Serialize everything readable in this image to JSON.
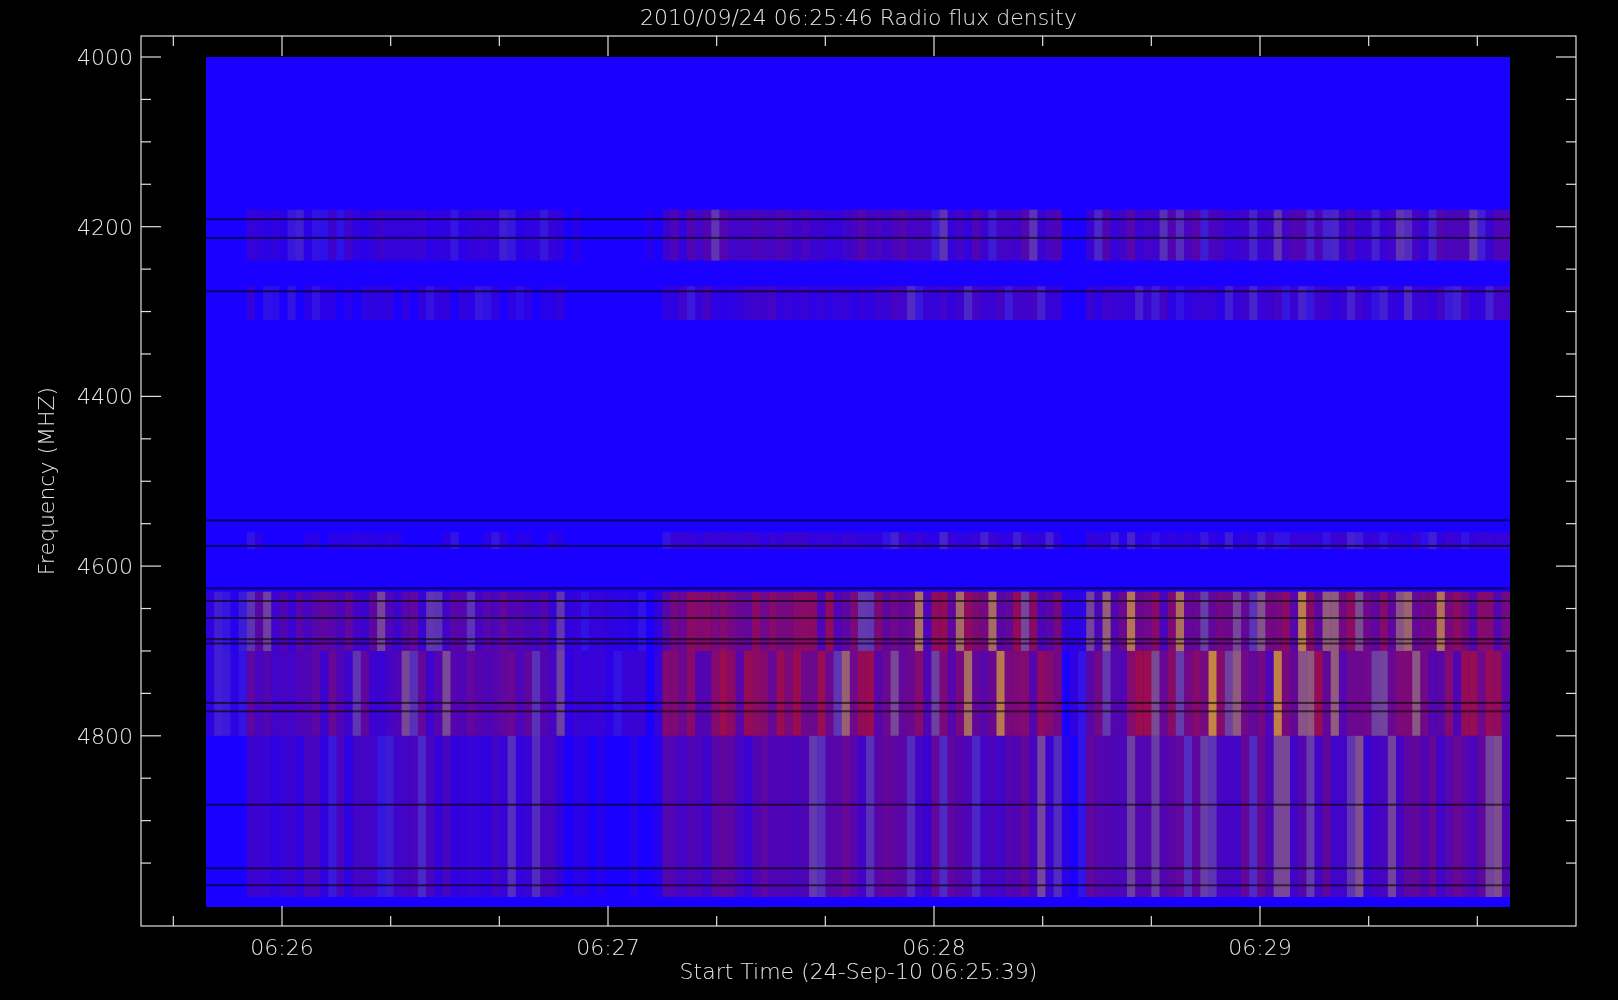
{
  "title": "2010/09/24 06:25:46 Radio flux density",
  "y_axis": {
    "label": "Frequency (MHZ)",
    "tick_labels": [
      "4000",
      "4200",
      "4400",
      "4600",
      "4800"
    ]
  },
  "x_axis": {
    "label": "Start Time (24-Sep-10 06:25:39)",
    "tick_labels": [
      "06:26",
      "06:27",
      "06:28",
      "06:29"
    ]
  }
}
